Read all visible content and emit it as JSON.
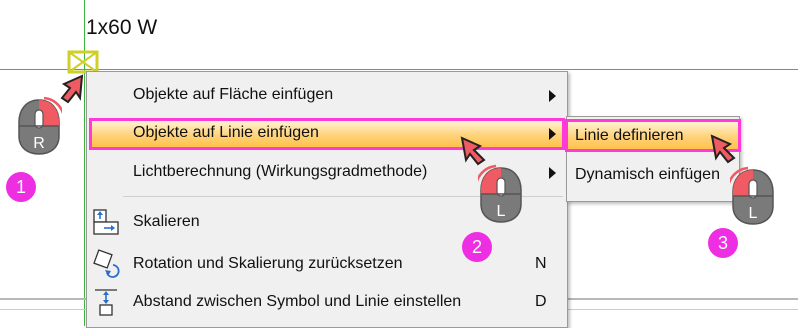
{
  "lamp": {
    "label": "1x60 W"
  },
  "context_menu": {
    "items": [
      {
        "label": "Objekte auf Fläche einfügen",
        "has_submenu": true
      },
      {
        "label": "Objekte auf Linie einfügen",
        "has_submenu": true,
        "highlighted": true
      },
      {
        "label": "Lichtberechnung (Wirkungsgradmethode)",
        "has_submenu": true
      },
      {
        "label": "Skalieren",
        "icon": "scale-icon"
      },
      {
        "label": "Rotation und Skalierung zurücksetzen",
        "icon": "reset-rotation-icon",
        "shortcut": "N"
      },
      {
        "label": "Abstand zwischen Symbol und Linie einstellen",
        "icon": "distance-icon",
        "shortcut": "D"
      }
    ]
  },
  "submenu": {
    "items": [
      {
        "label": "Linie definieren",
        "highlighted": true
      },
      {
        "label": "Dynamisch einfügen"
      }
    ]
  },
  "steps": [
    {
      "number": "1",
      "mouse_button": "R"
    },
    {
      "number": "2",
      "mouse_button": "L"
    },
    {
      "number": "3",
      "mouse_button": "L"
    }
  ],
  "colors": {
    "highlight_border": "#ff3ad6",
    "badge": "#ee2ee2",
    "highlight_fill": "#ffd27a"
  }
}
